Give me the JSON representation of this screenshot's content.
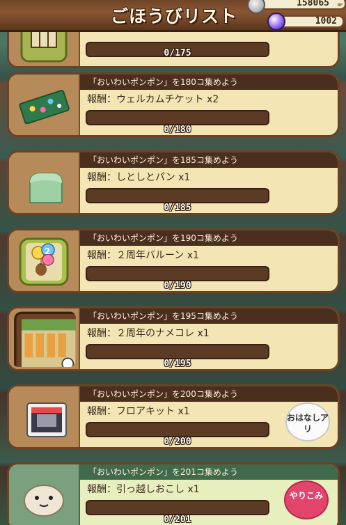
{
  "header": {
    "title": "ごほうびリスト",
    "np_value": "158065",
    "np_unit": "NP",
    "gem_value": "1002"
  },
  "cards": [
    {
      "theme": "brown",
      "banner": "",
      "reward": "",
      "progress": "0/175",
      "has_banner": false,
      "icon": "shoji-item-icon"
    },
    {
      "theme": "brown",
      "banner": "「おいわいポンポン」を180コ集めよう",
      "reward": "報酬：ウェルカムチケット x2",
      "progress": "0/180",
      "icon": "welcome-ticket-icon"
    },
    {
      "theme": "brown",
      "banner": "「おいわいポンポン」を185コ集めよう",
      "reward": "報酬：しとしとパン x1",
      "progress": "0/185",
      "icon": "bread-icon"
    },
    {
      "theme": "brown",
      "banner": "「おいわいポンポン」を190コ集めよう",
      "reward": "報酬：２周年バルーン x1",
      "progress": "0/190",
      "icon": "balloon-icon"
    },
    {
      "theme": "brown",
      "banner": "「おいわいポンポン」を195コ集めよう",
      "reward": "報酬：２周年のナメコレ x1",
      "progress": "0/195",
      "icon": "nameko-collection-icon"
    },
    {
      "theme": "brown",
      "banner": "「おいわいポンポン」を200コ集めよう",
      "reward": "報酬：フロアキット x1",
      "progress": "0/200",
      "icon": "floor-kit-icon",
      "bubble": {
        "style": "white",
        "text": "おはなしアリ"
      }
    },
    {
      "theme": "green",
      "banner": "「おいわいポンポン」を201コ集めよう",
      "reward": "報酬：引っ越しおこし x1",
      "progress": "0/201",
      "icon": "okoshi-icon",
      "bubble": {
        "style": "pink",
        "text": "やりこみ"
      }
    }
  ]
}
